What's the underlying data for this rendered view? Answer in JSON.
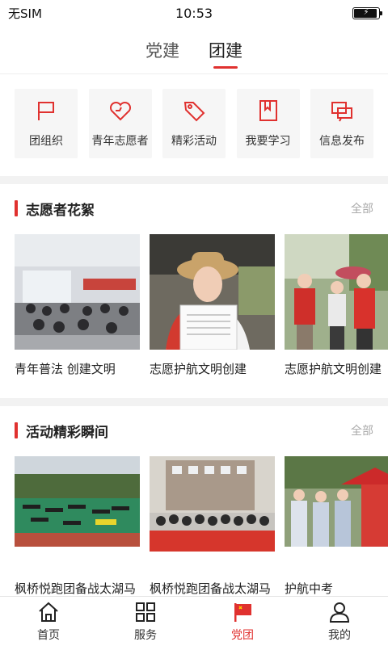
{
  "status": {
    "carrier": "无SIM",
    "time": "10:53"
  },
  "top_tabs": [
    {
      "label": "党建",
      "active": false
    },
    {
      "label": "团建",
      "active": true
    }
  ],
  "menu": [
    {
      "label": "团组织",
      "icon": "flag-icon"
    },
    {
      "label": "青年志愿者",
      "icon": "heart-icon"
    },
    {
      "label": "精彩活动",
      "icon": "tag-icon"
    },
    {
      "label": "我要学习",
      "icon": "bookmark-icon"
    },
    {
      "label": "信息发布",
      "icon": "message-icon"
    }
  ],
  "volunteer_section": {
    "title": "志愿者花絮",
    "more": "全部",
    "cards": [
      {
        "caption": "青年普法 创建文明"
      },
      {
        "caption": "志愿护航文明创建"
      },
      {
        "caption": "志愿护航文明创建"
      }
    ]
  },
  "activity_section": {
    "title": "活动精彩瞬间",
    "more": "全部",
    "cards": [
      {
        "caption": "枫桥悦跑团备战太湖马拉松"
      },
      {
        "caption": "枫桥悦跑团备战太湖马拉松"
      },
      {
        "caption": "护航中考"
      }
    ]
  },
  "bottom_nav": [
    {
      "label": "首页",
      "icon": "home-icon",
      "active": false
    },
    {
      "label": "服务",
      "icon": "grid-icon",
      "active": false
    },
    {
      "label": "党团",
      "icon": "party-flag-icon",
      "active": true
    },
    {
      "label": "我的",
      "icon": "user-icon",
      "active": false
    }
  ],
  "colors": {
    "accent": "#e0312f",
    "muted": "#aaaaaa",
    "tile_bg": "#f6f6f6"
  }
}
